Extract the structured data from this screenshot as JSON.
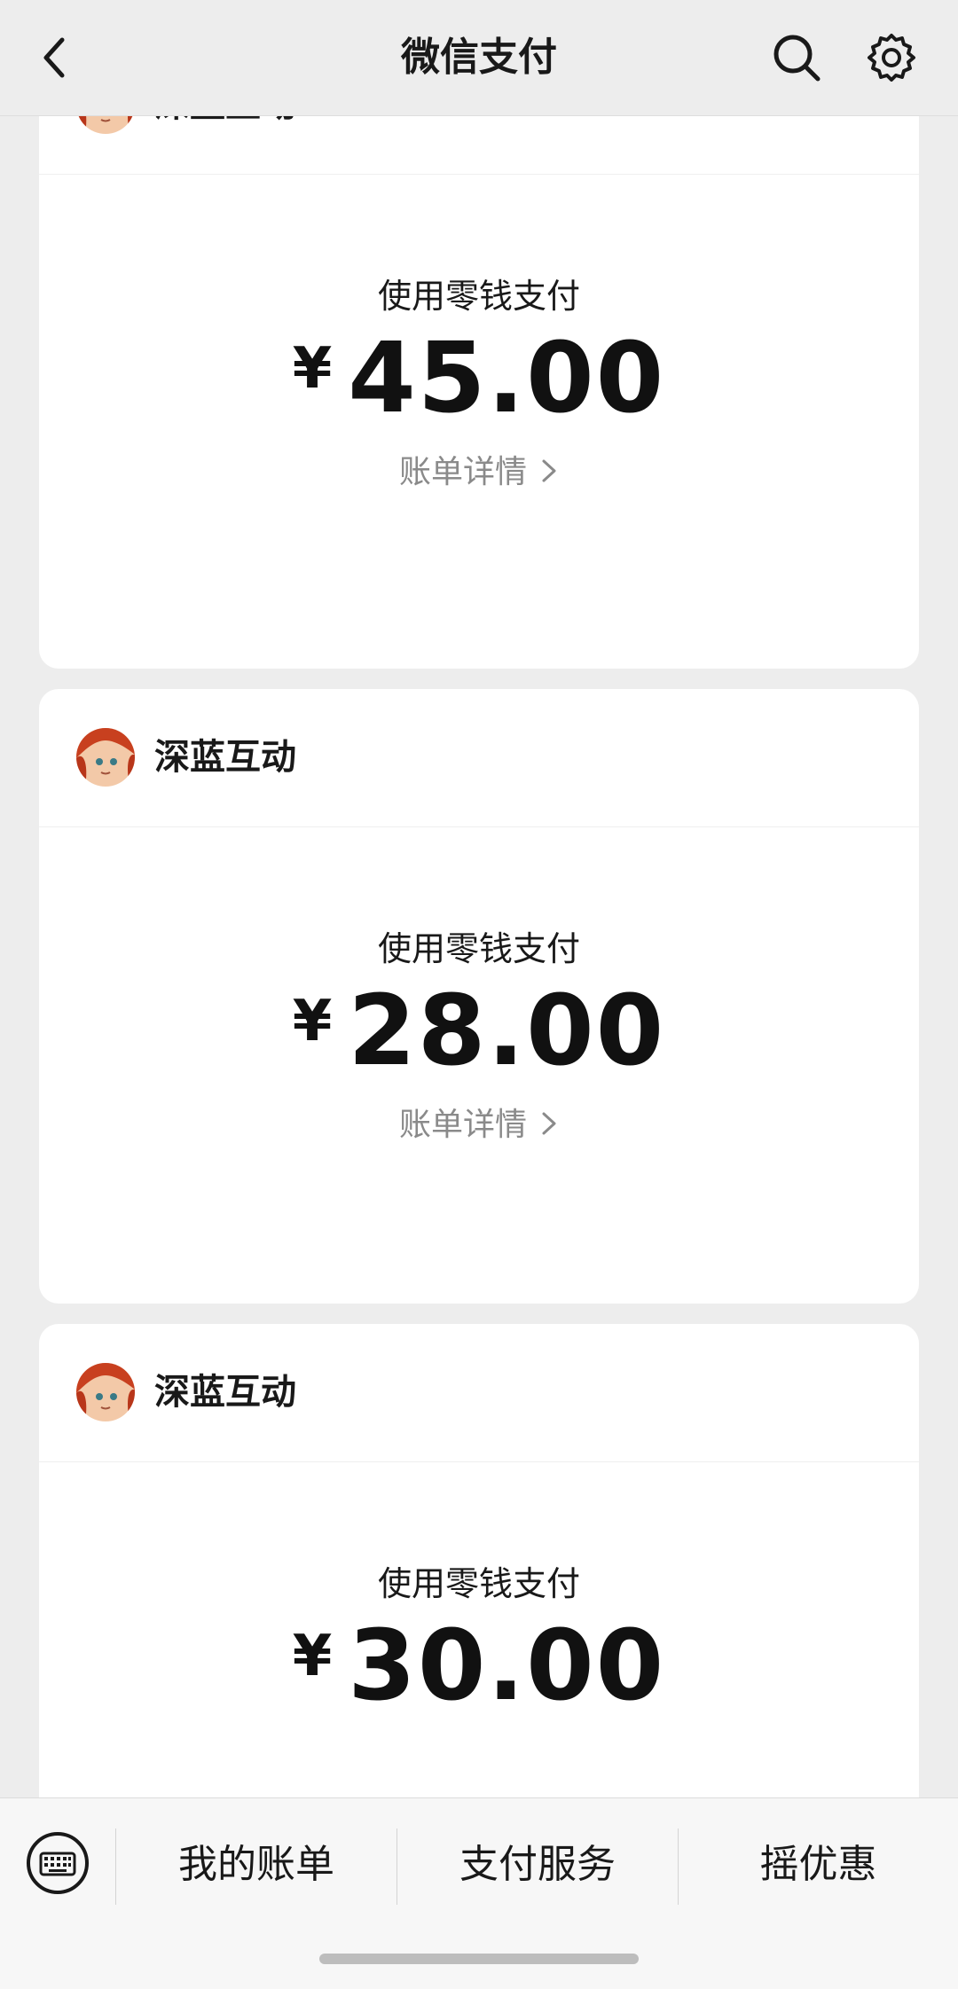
{
  "header": {
    "title": "微信支付"
  },
  "cards": [
    {
      "merchant": "深蓝互动",
      "pay_method": "使用零钱支付",
      "currency": "¥",
      "amount": "45.00",
      "detail_link": "账单详情"
    },
    {
      "merchant": "深蓝互动",
      "pay_method": "使用零钱支付",
      "currency": "¥",
      "amount": "28.00",
      "detail_link": "账单详情"
    },
    {
      "merchant": "深蓝互动",
      "pay_method": "使用零钱支付",
      "currency": "¥",
      "amount": "30.00"
    }
  ],
  "bottom_menu": {
    "items": [
      {
        "label": "我的账单"
      },
      {
        "label": "支付服务"
      },
      {
        "label": "摇优惠"
      }
    ]
  },
  "icons": {
    "back": "chevron-left-icon",
    "search": "search-icon",
    "settings": "gear-icon",
    "keyboard": "keyboard-icon"
  },
  "colors": {
    "background": "#ededed",
    "card": "#ffffff",
    "text_primary": "#191919",
    "text_secondary": "#8a8a8a"
  }
}
